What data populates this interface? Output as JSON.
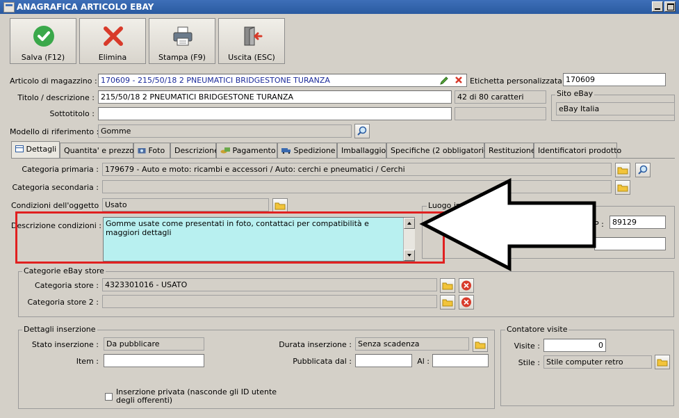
{
  "window": {
    "title": "ANAGRAFICA ARTICOLO EBAY"
  },
  "toolbar": {
    "save_label": "Salva (F12)",
    "delete_label": "Elimina",
    "print_label": "Stampa (F9)",
    "exit_label": "Uscita (ESC)"
  },
  "header": {
    "articolo_label": "Articolo di magazzino :",
    "articolo_value": "170609 - 215/50/18 2 PNEUMATICI BRIDGESTONE TURANZA",
    "etichetta_label": "Etichetta personalizzata :",
    "etichetta_value": "170609",
    "titolo_label": "Titolo / descrizione :",
    "titolo_value": "215/50/18 2 PNEUMATICI BRIDGESTONE TURANZA",
    "titolo_counter": "42 di 80 caratteri",
    "sottotitolo_label": "Sottotitolo :",
    "sottotitolo_value": "",
    "sito_title": "Sito eBay",
    "sito_value": "eBay Italia",
    "modello_label": "Modello di riferimento :",
    "modello_value": "Gomme"
  },
  "tabs": [
    {
      "label": "Dettagli"
    },
    {
      "label": "Quantita' e prezzo"
    },
    {
      "label": "Foto"
    },
    {
      "label": "Descrizione"
    },
    {
      "label": "Pagamento"
    },
    {
      "label": "Spedizione"
    },
    {
      "label": "Imballaggio"
    },
    {
      "label": "Specifiche (2 obbligatorie)"
    },
    {
      "label": "Restituzione"
    },
    {
      "label": "Identificatori prodotto"
    }
  ],
  "dettagli": {
    "cat_primaria_label": "Categoria primaria :",
    "cat_primaria_value": "179679 - Auto e moto: ricambi e accessori / Auto: cerchi e pneumatici / Cerchi",
    "cat_secondaria_label": "Categoria secondaria :",
    "cat_secondaria_value": "",
    "condizioni_label": "Condizioni dell'oggetto :",
    "condizioni_value": "Usato",
    "descr_cond_label": "Descrizione condizioni :",
    "descr_cond_value": "Gomme usate come presentati in foto, contattaci per compatibilità e maggiori dettagli",
    "luogo_title": "Luogo in",
    "cap_label": "P :",
    "cap_value": "89129",
    "luogo_value": ""
  },
  "store": {
    "title": "Categorie eBay store",
    "cat_store_label": "Categoria store :",
    "cat_store_value": "4323301016 - USATO",
    "cat_store2_label": "Categoria store 2 :",
    "cat_store2_value": ""
  },
  "inserzione": {
    "title": "Dettagli inserzione",
    "stato_label": "Stato inserzione :",
    "stato_value": "Da pubblicare",
    "item_label": "Item :",
    "item_value": "",
    "durata_label": "Durata inserzione :",
    "durata_value": "Senza scadenza",
    "pubblicata_label": "Pubblicata dal :",
    "pubblicata_value": "",
    "al_label": "Al :",
    "al_value": "",
    "privata_label": "Inserzione privata (nasconde gli ID utente degli offerenti)"
  },
  "contatore": {
    "title": "Contatore visite",
    "visite_label": "Visite :",
    "visite_value": "0",
    "stile_label": "Stile :",
    "stile_value": "Stile computer retro"
  },
  "colors": {
    "highlight_box": "#e02020",
    "title_bar": "#2a5aa0",
    "teal_field": "#b8f0f0"
  }
}
